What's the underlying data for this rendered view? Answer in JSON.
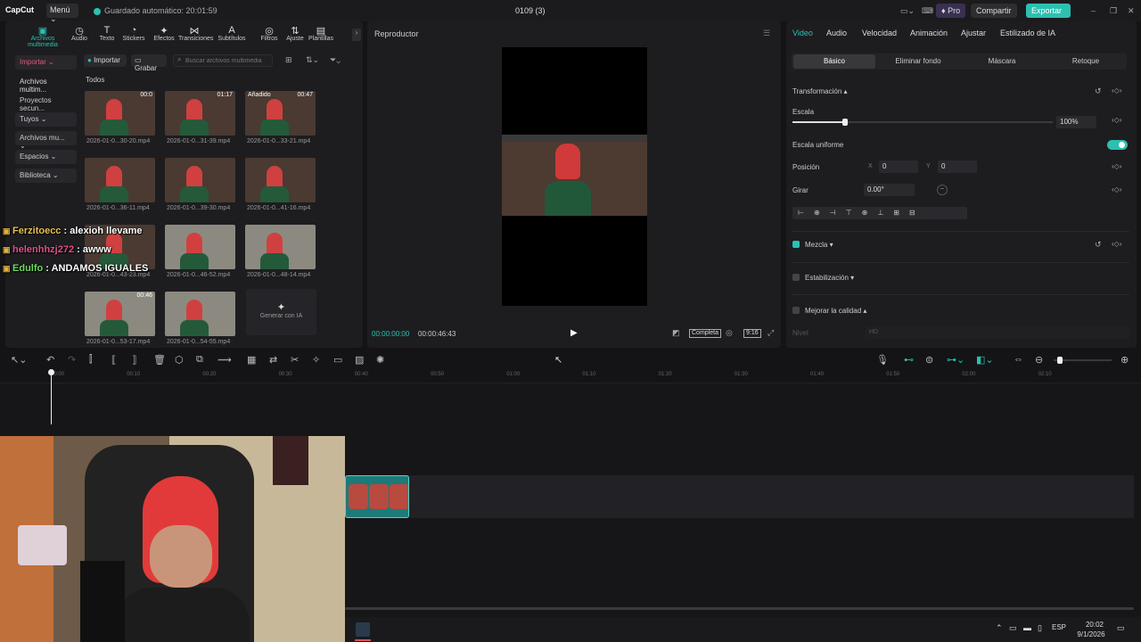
{
  "topbar": {
    "logo": "CapCut",
    "menu": "Menú ⌄",
    "autosave": "Guardado automático: 20:01:59",
    "project": "0109 (3)",
    "pro": "♦ Pro",
    "share": "Compartir",
    "export": "Exportar"
  },
  "toolbar": [
    {
      "label": "Archivos multimedia",
      "icon": "▣"
    },
    {
      "label": "Audio",
      "icon": "◷"
    },
    {
      "label": "Texto",
      "icon": "T"
    },
    {
      "label": "Stickers",
      "icon": "◔"
    },
    {
      "label": "Efectos",
      "icon": "✦"
    },
    {
      "label": "Transiciones",
      "icon": "⋈"
    },
    {
      "label": "Subtítulos",
      "icon": "A"
    },
    {
      "label": "Filtros",
      "icon": "◎"
    },
    {
      "label": "Ajuste",
      "icon": "⇅"
    },
    {
      "label": "Plantillas",
      "icon": "▤"
    }
  ],
  "media": {
    "import": "Importar",
    "record": "Grabar",
    "search_placeholder": "Buscar archivos multimedia",
    "all": "Todos",
    "generate": "Generar con IA"
  },
  "sidebar": [
    {
      "label": "Importar ⌄"
    },
    {
      "label": "Archivos multim..."
    },
    {
      "label": "Proyectos secun..."
    },
    {
      "label": "Tuyos ⌄"
    },
    {
      "label": "Archivos mu... ⌄"
    },
    {
      "label": "Espacios ⌄"
    },
    {
      "label": "Biblioteca ⌄"
    }
  ],
  "thumbs": [
    {
      "caption": "2026-01-0...30-20.mp4",
      "duration": "00:0",
      "tag": ""
    },
    {
      "caption": "2026-01-0...31-39.mp4",
      "duration": "01:17",
      "tag": ""
    },
    {
      "caption": "2026-01-0...33-21.mp4",
      "duration": "00:47",
      "tag": "Añadido"
    },
    {
      "caption": "2026-01-0...36-11.mp4",
      "duration": "",
      "tag": ""
    },
    {
      "caption": "2026-01-0...39-30.mp4",
      "duration": "",
      "tag": ""
    },
    {
      "caption": "2026-01-0...41-16.mp4",
      "duration": "",
      "tag": ""
    },
    {
      "caption": "2026-01-0...43-23.mp4",
      "duration": "",
      "tag": ""
    },
    {
      "caption": "2026-01-0...46-52.mp4",
      "duration": "",
      "tag": ""
    },
    {
      "caption": "2026-01-0...48-14.mp4",
      "duration": "",
      "tag": ""
    },
    {
      "caption": "2026-01-0...53-17.mp4",
      "duration": "00:46",
      "tag": ""
    },
    {
      "caption": "2026-01-0...54-55.mp4",
      "duration": "",
      "tag": ""
    }
  ],
  "chat": [
    {
      "user": "Ferzitoecc",
      "msg": " : alexioh llevame",
      "color": "#e8c050"
    },
    {
      "user": "helenhhzj272",
      "msg": " : awww",
      "color": "#e0508a"
    },
    {
      "user": "Edulfo",
      "msg": " : ANDAMOS IGUALES",
      "color": "#70d860"
    }
  ],
  "player": {
    "title": "Reproductor",
    "time_current": "00:00:00:00",
    "time_total": "00:00:46:43",
    "full": "Completa",
    "ratio": "9:16"
  },
  "props": {
    "tabs": [
      "Video",
      "Audio",
      "Velocidad",
      "Animación",
      "Ajustar",
      "Estilizado de IA"
    ],
    "subtabs": [
      "Básico",
      "Eliminar fondo",
      "Máscara",
      "Retoque"
    ],
    "transform": "Transformación ▴",
    "scale_label": "Escala",
    "scale_value": "100%",
    "scale_level": 0.45,
    "uniform": "Escala uniforme",
    "position": "Posición",
    "x_label": "X",
    "x_value": "0",
    "y_label": "Y",
    "y_value": "0",
    "rotate": "Girar",
    "rotate_value": "0.00°",
    "blend": "Mezcla ▾",
    "stabilize": "Estabilización ▾",
    "enhance": "Mejorar la calidad ▴",
    "level": "Nivel",
    "level_value": "HD"
  },
  "ruler": [
    "00:00",
    "00:10",
    "00:20",
    "00:30",
    "00:40",
    "00:50",
    "01:00",
    "01:10",
    "01:20",
    "01:30",
    "01:40",
    "01:50",
    "02:00",
    "02:10"
  ],
  "taskbar": {
    "lang": "ESP",
    "time": "20:02",
    "date": "9/1/2026"
  },
  "colors": {
    "accent": "#2bc0b0",
    "clip": "#1e7a78"
  }
}
